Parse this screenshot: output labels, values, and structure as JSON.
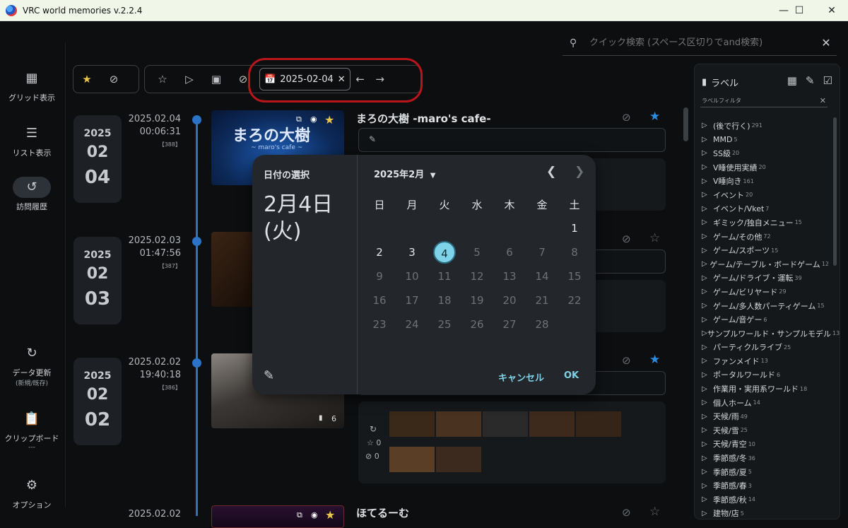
{
  "window": {
    "title": "VRC world memories v.2.2.4",
    "min": "—",
    "max": "☐",
    "close": "✕"
  },
  "search": {
    "placeholder": "クイック検索 (スペース区切りでand検索)"
  },
  "sidebar": {
    "items": [
      {
        "label": "グリッド表示"
      },
      {
        "label": "リスト表示"
      },
      {
        "label": "訪問履歴"
      },
      {
        "label": "データ更新",
        "sub": "(新規/既存)"
      },
      {
        "label": "クリップボード",
        "sub": "---"
      },
      {
        "label": "オプション"
      }
    ]
  },
  "filter": {
    "date": "2025-02-04"
  },
  "entries": [
    {
      "year": "2025",
      "month": "02",
      "day": "04",
      "date": "2025.02.04",
      "time": "00:06:31",
      "index": "【388】",
      "title": "まろの大樹 -maro's cafe-",
      "thumb_text": "まろの大樹",
      "thumb_sub": "~ maro's cafe ~",
      "starred": true
    },
    {
      "year": "2025",
      "month": "02",
      "day": "03",
      "date": "2025.02.03",
      "time": "01:47:56",
      "index": "【387】",
      "starred": false
    },
    {
      "year": "2025",
      "month": "02",
      "day": "02",
      "date": "2025.02.02",
      "time": "19:40:18",
      "index": "【386】",
      "photo_count": "6",
      "reloads": "",
      "stars": "0",
      "hidden": "0",
      "starred": true
    },
    {
      "date": "2025.02.02",
      "title": "ほてるーむ",
      "starred": false
    }
  ],
  "labels_panel": {
    "title": "ラベル",
    "filter_placeholder": "ラベルフィルタ",
    "items": [
      {
        "name": "(後で行く)",
        "count": "291"
      },
      {
        "name": "MMD",
        "count": "5"
      },
      {
        "name": "SS級",
        "count": "20"
      },
      {
        "name": "V睡使用実績",
        "count": "20"
      },
      {
        "name": "V睡向き",
        "count": "161"
      },
      {
        "name": "イベント",
        "count": "20"
      },
      {
        "name": "イベント/Vket",
        "count": "7"
      },
      {
        "name": "ギミック/独自メニュー",
        "count": "15"
      },
      {
        "name": "ゲーム/その他",
        "count": "72"
      },
      {
        "name": "ゲーム/スポーツ",
        "count": "15"
      },
      {
        "name": "ゲーム/テーブル・ボードゲーム",
        "count": "12"
      },
      {
        "name": "ゲーム/ドライブ・運転",
        "count": "39"
      },
      {
        "name": "ゲーム/ビリヤード",
        "count": "29"
      },
      {
        "name": "ゲーム/多人数パーティゲーム",
        "count": "15"
      },
      {
        "name": "ゲーム/音ゲー",
        "count": "6"
      },
      {
        "name": "サンプルワールド・サンプルモデル",
        "count": "13"
      },
      {
        "name": "パーティクルライブ",
        "count": "25"
      },
      {
        "name": "ファンメイド",
        "count": "13"
      },
      {
        "name": "ポータルワールド",
        "count": "6"
      },
      {
        "name": "作業用・実用系ワールド",
        "count": "18"
      },
      {
        "name": "個人ホーム",
        "count": "14"
      },
      {
        "name": "天候/雨",
        "count": "49"
      },
      {
        "name": "天候/雪",
        "count": "25"
      },
      {
        "name": "天候/青空",
        "count": "10"
      },
      {
        "name": "季節感/冬",
        "count": "36"
      },
      {
        "name": "季節感/夏",
        "count": "5"
      },
      {
        "name": "季節感/春",
        "count": "3"
      },
      {
        "name": "季節感/秋",
        "count": "14"
      },
      {
        "name": "建物/店",
        "count": "5"
      }
    ]
  },
  "date_dialog": {
    "heading": "日付の選択",
    "selected_line1": "2月4日",
    "selected_line2": "(火)",
    "month_label": "2025年2月",
    "weekdays": [
      "日",
      "月",
      "火",
      "水",
      "木",
      "金",
      "土"
    ],
    "weeks": [
      [
        "",
        "",
        "",
        "",
        "",
        "",
        "1"
      ],
      [
        "2",
        "3",
        "4",
        "5",
        "6",
        "7",
        "8"
      ],
      [
        "9",
        "10",
        "11",
        "12",
        "13",
        "14",
        "15"
      ],
      [
        "16",
        "17",
        "18",
        "19",
        "20",
        "21",
        "22"
      ],
      [
        "23",
        "24",
        "25",
        "26",
        "27",
        "28",
        ""
      ]
    ],
    "selected_day": "4",
    "enabled_days": [
      "1",
      "2",
      "3",
      "4"
    ],
    "cancel": "キャンセル",
    "ok": "OK"
  },
  "colors": {
    "accent": "#7fd3e8",
    "timeline": "#2b73c7",
    "star": "#e8c64a",
    "star_blue": "#2d8ce0",
    "highlight": "#b8161a"
  }
}
